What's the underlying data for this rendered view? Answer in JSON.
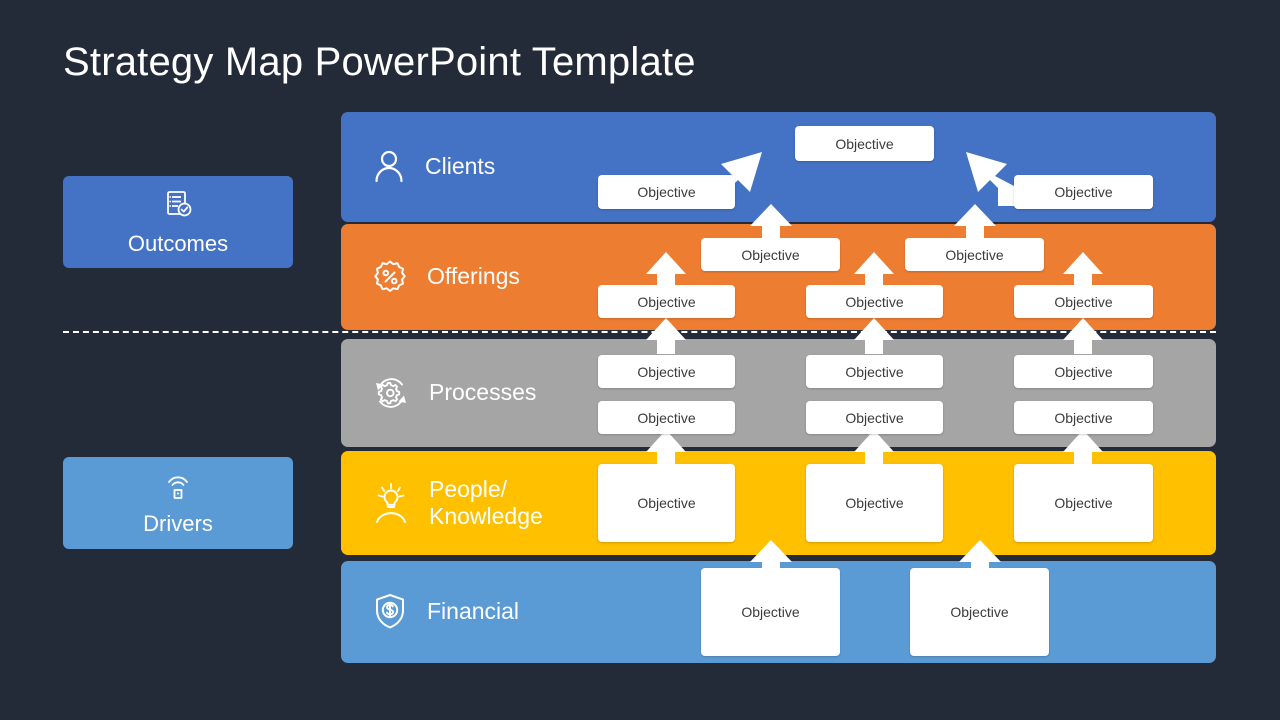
{
  "page": {
    "title": "Strategy Map PowerPoint Template",
    "background_color": "#232b38"
  },
  "side_categories": [
    {
      "label": "Outcomes",
      "icon": "clipboard-check-icon",
      "color": "#4472c4"
    },
    {
      "label": "Drivers",
      "icon": "signal-remote-icon",
      "color": "#5b9bd5"
    }
  ],
  "divider": {
    "style": "dashed",
    "color": "#ffffff"
  },
  "rows": [
    {
      "id": "clients",
      "label": "Clients",
      "icon": "person-icon",
      "color": "#4472c4",
      "objectives": [
        {
          "text": "Objective"
        },
        {
          "text": "Objective"
        },
        {
          "text": "Objective"
        }
      ]
    },
    {
      "id": "offerings",
      "label": "Offerings",
      "icon": "percent-badge-icon",
      "color": "#ed7d31",
      "objectives": [
        {
          "text": "Objective"
        },
        {
          "text": "Objective"
        },
        {
          "text": "Objective"
        },
        {
          "text": "Objective"
        },
        {
          "text": "Objective"
        }
      ]
    },
    {
      "id": "processes",
      "label": "Processes",
      "icon": "gear-refresh-icon",
      "color": "#a5a5a5",
      "objectives": [
        {
          "text": "Objective"
        },
        {
          "text": "Objective"
        },
        {
          "text": "Objective"
        },
        {
          "text": "Objective"
        },
        {
          "text": "Objective"
        },
        {
          "text": "Objective"
        }
      ]
    },
    {
      "id": "people",
      "label": "People/\nKnowledge",
      "icon": "lightbulb-person-icon",
      "color": "#ffc000",
      "objectives": [
        {
          "text": "Objective"
        },
        {
          "text": "Objective"
        },
        {
          "text": "Objective"
        }
      ]
    },
    {
      "id": "financial",
      "label": "Financial",
      "icon": "shield-dollar-icon",
      "color": "#5b9bd5",
      "objectives": [
        {
          "text": "Objective"
        },
        {
          "text": "Objective"
        }
      ]
    }
  ]
}
